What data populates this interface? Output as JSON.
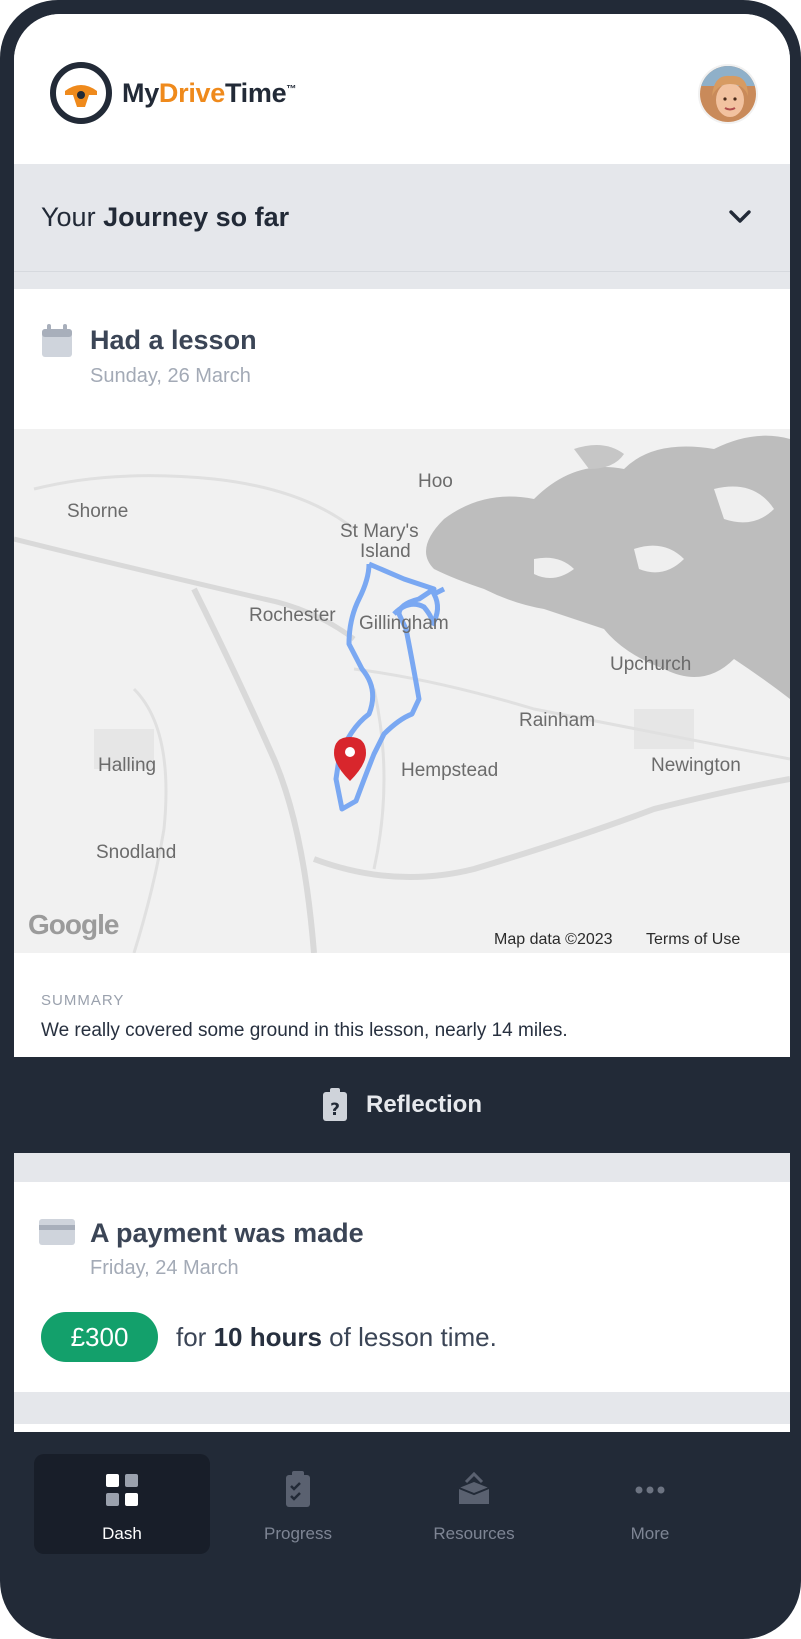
{
  "header": {
    "logo_my": "My",
    "logo_drive": "Drive",
    "logo_time": "Time",
    "logo_tm": "™"
  },
  "journey": {
    "prefix": "Your ",
    "title_bold": "Journey so far"
  },
  "lesson_card": {
    "title": "Had a lesson",
    "date": "Sunday, 26 March",
    "map": {
      "places": [
        "Hoo",
        "Shorne",
        "St Mary's",
        "Island",
        "Rochester",
        "Gillingham",
        "Upchurch",
        "Rainham",
        "Halling",
        "Hempstead",
        "Newington",
        "Snodland"
      ],
      "google": "Google",
      "map_data": "Map data ©2023",
      "terms": "Terms of Use"
    },
    "summary_label": "SUMMARY",
    "summary_text": "We really covered some ground in this lesson, nearly 14 miles.",
    "reflection_label": "Reflection"
  },
  "payment_card": {
    "title": "A payment was made",
    "date": "Friday, 24 March",
    "amount": "£300",
    "note_prefix": "for ",
    "note_bold": "10 hours",
    "note_suffix": " of lesson time."
  },
  "nav": {
    "items": [
      {
        "label": "Dash",
        "icon": "grid-icon",
        "active": true
      },
      {
        "label": "Progress",
        "icon": "clipboard-check-icon",
        "active": false
      },
      {
        "label": "Resources",
        "icon": "box-icon",
        "active": false
      },
      {
        "label": "More",
        "icon": "more-dots-icon",
        "active": false
      }
    ]
  },
  "colors": {
    "dark": "#222a37",
    "brand_orange": "#ef8a1c",
    "payment_green": "#13a06b",
    "route_blue": "#7aa8f2",
    "pin_red": "#d8262c"
  }
}
